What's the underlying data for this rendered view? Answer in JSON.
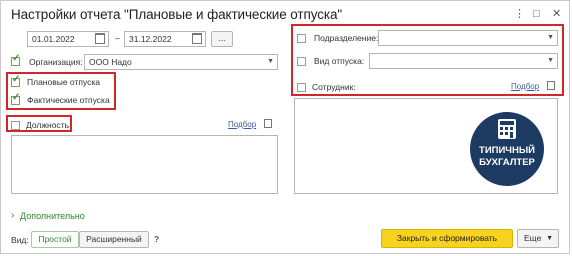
{
  "window": {
    "title": "Настройки отчета \"Плановые и фактические отпуска\"",
    "menu_icon": "⋮",
    "maximize_icon": "□",
    "close_icon": "✕"
  },
  "period": {
    "start": "01.01.2022",
    "separator": "–",
    "end": "31.12.2022",
    "more_button": "..."
  },
  "organization": {
    "label": "Организация:",
    "value": "ООО Надо",
    "checked": true
  },
  "planned": {
    "label": "Плановые отпуска",
    "checked": true
  },
  "actual": {
    "label": "Фактические отпуска",
    "checked": true
  },
  "position": {
    "label": "Должность:",
    "checked": false,
    "pick_link": "Подбор"
  },
  "right": {
    "department_label": "Подразделение:",
    "vacation_type_label": "Вид отпуска:",
    "employee_label": "Сотрудник:",
    "pick_link": "Подбор"
  },
  "logo": {
    "line1": "ТИПИЧНЫЙ",
    "line2": "БУХГАЛТЕР"
  },
  "footer": {
    "more_settings": "Дополнительно",
    "view_label": "Вид:",
    "view_simple": "Простой",
    "view_extended": "Расширенный",
    "help": "?",
    "generate_button": "Закрыть и сформировать",
    "more_button": "Еще"
  }
}
